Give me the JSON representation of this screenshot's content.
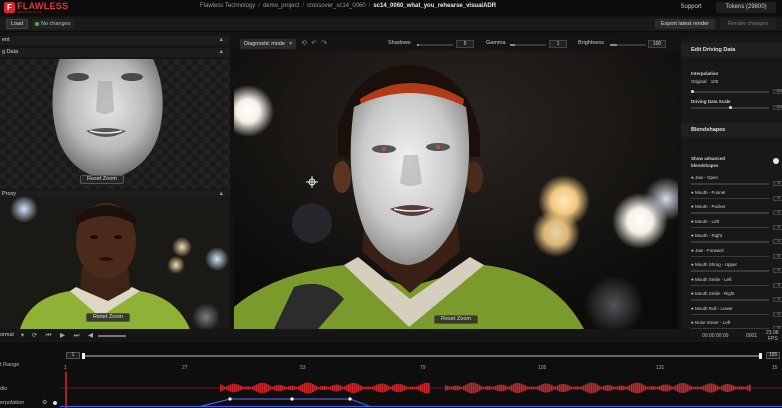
{
  "app": {
    "logo_text": "FLAWLESS",
    "logo_sub": "INNOVATIONS",
    "breadcrumb": [
      "Flawless Technology",
      "demo_project",
      "crossover_sc14_0060",
      "sc14_0060_what_you_rehearse_visualADR"
    ],
    "support_label": "Support",
    "tokens_label": "Tokens (29800)"
  },
  "toolbar": {
    "load_label": "Load",
    "status_label": "No changes",
    "export_label": "Export latest render",
    "render_label": "Render changes"
  },
  "left_panel": {
    "section1_title": "ent",
    "section2_title": "g Data",
    "section3_title": "Proxy",
    "reset_zoom_label": "Reset Zoom"
  },
  "viewport": {
    "mode_label": "Diagnostic mode",
    "sliders": [
      {
        "label": "Shadows",
        "value": "5",
        "level": 0.05
      },
      {
        "label": "Gamma",
        "value": "1",
        "level": 0.15
      },
      {
        "label": "Brightness",
        "value": "100",
        "level": 0.2
      }
    ],
    "reset_zoom_label": "Reset Zoom"
  },
  "right_panel": {
    "title": "Edit Driving Data",
    "interpolation_label": "Interpolation",
    "original_label": "Original",
    "original_value": "100",
    "interp_value": "100",
    "driving_scale_label": "Driving Data Scale",
    "driving_scale_value": "100",
    "blendshapes_title": "Blendshapes",
    "show_advanced_label": "Show advanced",
    "show_advanced_label2": "blendshapes",
    "blendshapes": [
      {
        "label": "Jaw - Open",
        "value": "0"
      },
      {
        "label": "Mouth - Funnel",
        "value": "0"
      },
      {
        "label": "Mouth - Pucker",
        "value": "0"
      },
      {
        "label": "Mouth - Left",
        "value": "0"
      },
      {
        "label": "Mouth - Right",
        "value": "0"
      },
      {
        "label": "Jaw - Forward",
        "value": "0"
      },
      {
        "label": "Mouth Shrug - Upper",
        "value": "0"
      },
      {
        "label": "Mouth Smile - Left",
        "value": "0"
      },
      {
        "label": "Mouth Smile - Right",
        "value": "0"
      },
      {
        "label": "Mouth Roll - Lower",
        "value": "0"
      },
      {
        "label": "Nose Sneer - Left",
        "value": "0"
      }
    ]
  },
  "playback": {
    "speed_label": "ormal",
    "timecode": "00:00:00:00",
    "frame": "0001",
    "fps_value": "23.98",
    "fps_label": "FPS"
  },
  "timeline": {
    "range_label": "t Range",
    "range_start": "1",
    "range_end": "155",
    "ticks": [
      "1",
      "27",
      "53",
      "79",
      "105",
      "131",
      "15"
    ],
    "tracks": [
      "dio",
      "erpolation"
    ],
    "colors": {
      "audio": "#c9282c",
      "interpolation": "#4a5bd6",
      "accent": "#d7262e"
    }
  }
}
